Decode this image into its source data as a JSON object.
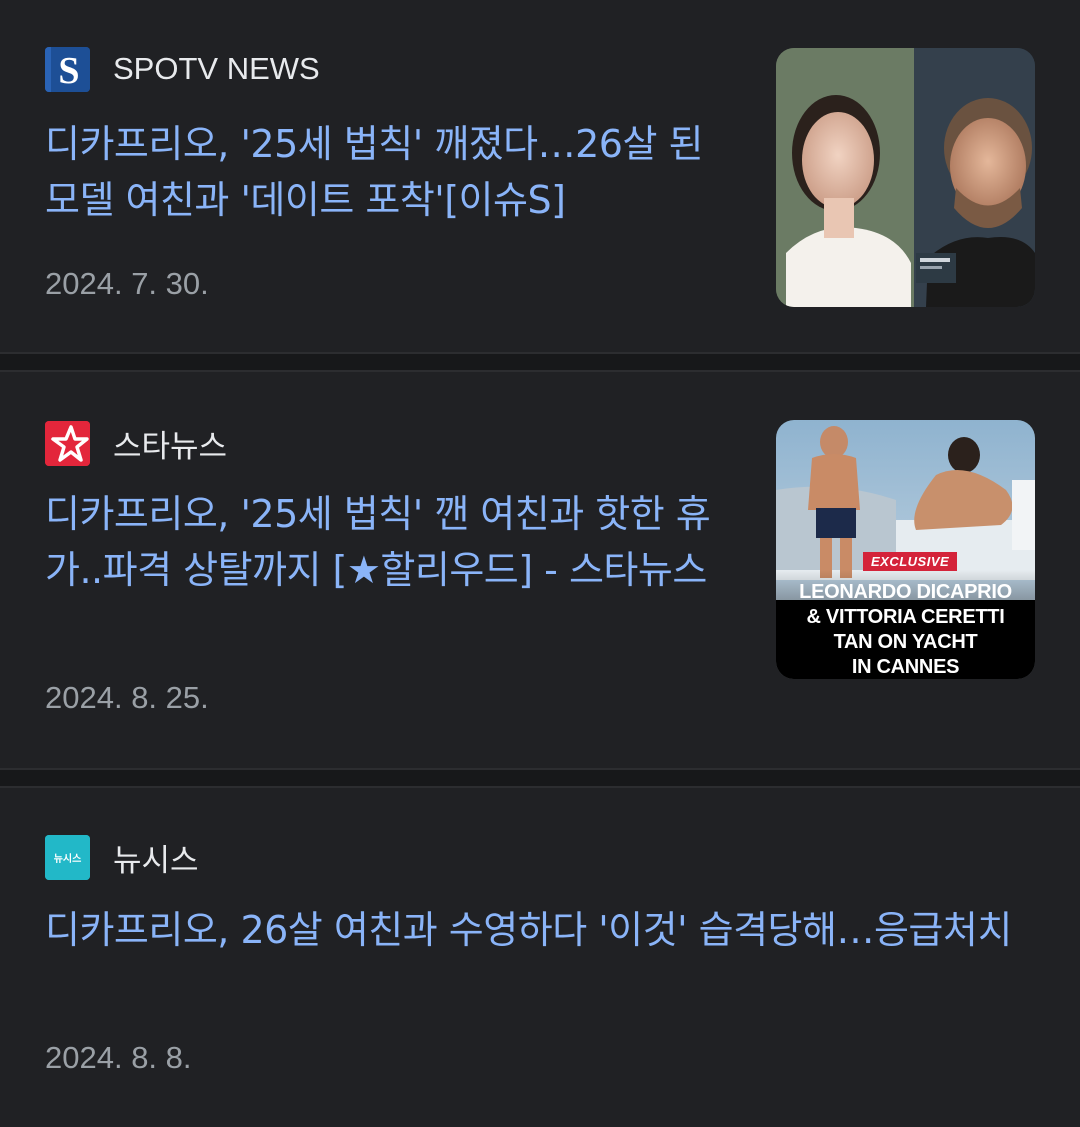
{
  "articles": [
    {
      "source": "SPOTV NEWS",
      "source_logo_letter": "S",
      "source_logo_color": "#1d4f96",
      "headline": "디카프리오, '25세 법칙' 깨졌다…26살 된 모델 여친과 '데이트 포착'[이슈S]",
      "date": "2024. 7. 30.",
      "thumbnail": "photo"
    },
    {
      "source": "스타뉴스",
      "source_logo_color": "#e3263b",
      "headline": "디카프리오, '25세 법칙' 깬 여친과 핫한 휴가..파격 상탈까지 [★할리우드] - 스타뉴스",
      "date": "2024. 8. 25.",
      "thumbnail": "photo",
      "thumb_badge": "EXCLUSIVE",
      "thumb_caption": "LEONARDO DICAPRIO\n& VITTORIA CERETTI\nTAN ON YACHT\nIN CANNES"
    },
    {
      "source": "뉴시스",
      "source_logo_text": "뉴시스",
      "source_logo_color": "#22b8c8",
      "headline": "디카프리오, 26살 여친과 수영하다 '이것' 습격당해…응급처치",
      "date": "2024. 8. 8."
    }
  ],
  "colors": {
    "background": "#202124",
    "separator": "#17181a",
    "headline": "#8ab4f8",
    "source_text": "#e8eaed",
    "date_text": "#9aa0a6"
  }
}
